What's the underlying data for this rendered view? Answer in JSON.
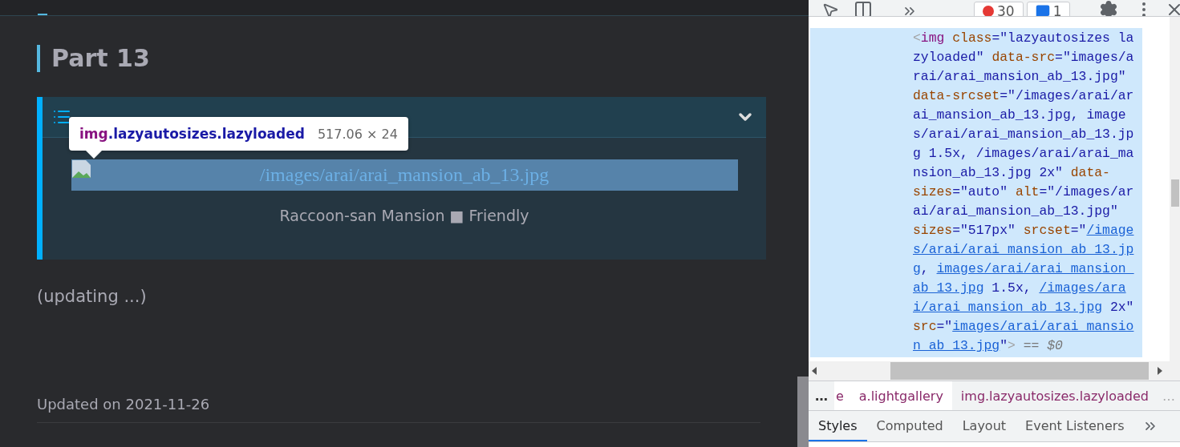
{
  "page": {
    "heading": "Part 13",
    "fold": {
      "expanded": true,
      "image_alt": "/images/arai/arai_mansion_ab_13.jpg",
      "caption": "Raccoon-san Mansion ■ Friendly"
    },
    "note": "(updating ...)",
    "updated": "Updated on 2021-11-26"
  },
  "tooltip": {
    "tag": "img",
    "classes": ".lazyautosizes.lazyloaded",
    "size": "517.06 × 24"
  },
  "devtools": {
    "toolbar": {
      "errors": "30",
      "messages": "1"
    },
    "code_lines": [
      [
        {
          "kind": "punct",
          "t": "<"
        },
        {
          "kind": "tag",
          "t": "img "
        },
        {
          "kind": "attr",
          "t": "class"
        },
        {
          "kind": "val",
          "t": "=\"lazyautosizes la"
        }
      ],
      [
        {
          "kind": "val",
          "t": "zyloaded\" "
        },
        {
          "kind": "attr",
          "t": "data-src"
        },
        {
          "kind": "val",
          "t": "=\"images/a"
        }
      ],
      [
        {
          "kind": "val",
          "t": "rai/arai_mansion_ab_13.jpg\""
        }
      ],
      [
        {
          "kind": "attr",
          "t": "data-srcset"
        },
        {
          "kind": "val",
          "t": "=\"/images/arai/ar"
        }
      ],
      [
        {
          "kind": "val",
          "t": "ai_mansion_ab_13.jpg, image"
        }
      ],
      [
        {
          "kind": "val",
          "t": "s/arai/arai_mansion_ab_13.jp"
        }
      ],
      [
        {
          "kind": "val",
          "t": "g 1.5x, /images/arai/arai_ma"
        }
      ],
      [
        {
          "kind": "val",
          "t": "nsion_ab_13.jpg 2x\" "
        },
        {
          "kind": "attr",
          "t": "data-"
        }
      ],
      [
        {
          "kind": "attr",
          "t": "sizes"
        },
        {
          "kind": "val",
          "t": "=\"auto\" "
        },
        {
          "kind": "attr",
          "t": "alt"
        },
        {
          "kind": "val",
          "t": "=\"/images/ar"
        }
      ],
      [
        {
          "kind": "val",
          "t": "ai/arai_mansion_ab_13.jpg\""
        }
      ],
      [
        {
          "kind": "attr",
          "t": "sizes"
        },
        {
          "kind": "val",
          "t": "=\"517px\" "
        },
        {
          "kind": "attr",
          "t": "srcset"
        },
        {
          "kind": "val",
          "t": "=\""
        },
        {
          "kind": "link",
          "t": "/image"
        }
      ],
      [
        {
          "kind": "link",
          "t": "s/arai/arai_mansion_ab_13.jp"
        }
      ],
      [
        {
          "kind": "link",
          "t": "g"
        },
        {
          "kind": "val",
          "t": ", "
        },
        {
          "kind": "link",
          "t": "images/arai/arai_mansion_"
        }
      ],
      [
        {
          "kind": "link",
          "t": "ab_13.jpg"
        },
        {
          "kind": "val",
          "t": " 1.5x, "
        },
        {
          "kind": "link",
          "t": "/images/ara"
        }
      ],
      [
        {
          "kind": "link",
          "t": "i/arai_mansion_ab_13.jpg"
        },
        {
          "kind": "val",
          "t": " 2x\""
        }
      ],
      [
        {
          "kind": "attr",
          "t": "src"
        },
        {
          "kind": "val",
          "t": "=\""
        },
        {
          "kind": "link",
          "t": "images/arai/arai_mansio"
        }
      ],
      [
        {
          "kind": "link",
          "t": "n_ab_13.jpg"
        },
        {
          "kind": "val",
          "t": "\""
        },
        {
          "kind": "punct",
          "t": ">"
        },
        {
          "kind": "comment",
          "t": " == $0"
        }
      ]
    ],
    "breadcrumbs_overflow_left": "…",
    "breadcrumbs": [
      {
        "label": "e",
        "selected": false
      },
      {
        "label": "a.lightgallery",
        "selected": false
      },
      {
        "label": "img.lazyautosizes.lazyloaded",
        "selected": true
      }
    ],
    "breadcrumbs_overflow_right": "…",
    "tabs": [
      {
        "label": "Styles",
        "selected": true
      },
      {
        "label": "Computed",
        "selected": false
      },
      {
        "label": "Layout",
        "selected": false
      },
      {
        "label": "Event Listeners",
        "selected": false
      }
    ]
  }
}
